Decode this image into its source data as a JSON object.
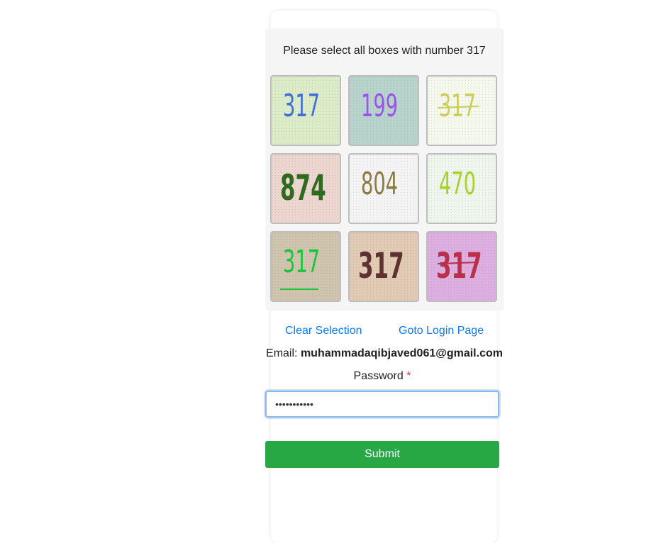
{
  "captcha": {
    "instruction": "Please select all boxes with number 317",
    "tiles": [
      {
        "number": "317",
        "bg": "#dcebc8",
        "color": "#3f6fd8",
        "style": "thin",
        "strike": false,
        "underline": false
      },
      {
        "number": "199",
        "bg": "#b7d3cc",
        "color": "#9a55e8",
        "style": "thin",
        "strike": false,
        "underline": false
      },
      {
        "number": "317",
        "bg": "#f5f8ec",
        "color": "#cccc5a",
        "style": "medium",
        "strike": true,
        "underline": false
      },
      {
        "number": "874",
        "bg": "#ecd6cf",
        "color": "#2e6b1e",
        "style": "bold",
        "strike": false,
        "underline": false
      },
      {
        "number": "804",
        "bg": "#f4f4f4",
        "color": "#8b7a45",
        "style": "medium",
        "strike": false,
        "underline": false
      },
      {
        "number": "470",
        "bg": "#eef5ec",
        "color": "#a6d22a",
        "style": "medium",
        "strike": false,
        "underline": false
      },
      {
        "number": "317",
        "bg": "#cfc4ae",
        "color": "#1bc43a",
        "style": "medium",
        "strike": false,
        "underline": true
      },
      {
        "number": "317",
        "bg": "#e2cbb5",
        "color": "#5e3232",
        "style": "bold",
        "strike": false,
        "underline": false
      },
      {
        "number": "317",
        "bg": "#dcafe0",
        "color": "#b8304a",
        "style": "bold",
        "strike": true,
        "underline": false
      }
    ]
  },
  "links": {
    "clear": "Clear Selection",
    "login": "Goto Login Page"
  },
  "email": {
    "label": "Email:",
    "value": "muhammadaqibjaved061@gmail.com"
  },
  "password": {
    "label": "Password",
    "required_mark": "*",
    "value": "•••••••••••"
  },
  "submit_label": "Submit",
  "colors": {
    "link": "#0d7bf0",
    "submit": "#28a745",
    "required": "#dc3545"
  }
}
